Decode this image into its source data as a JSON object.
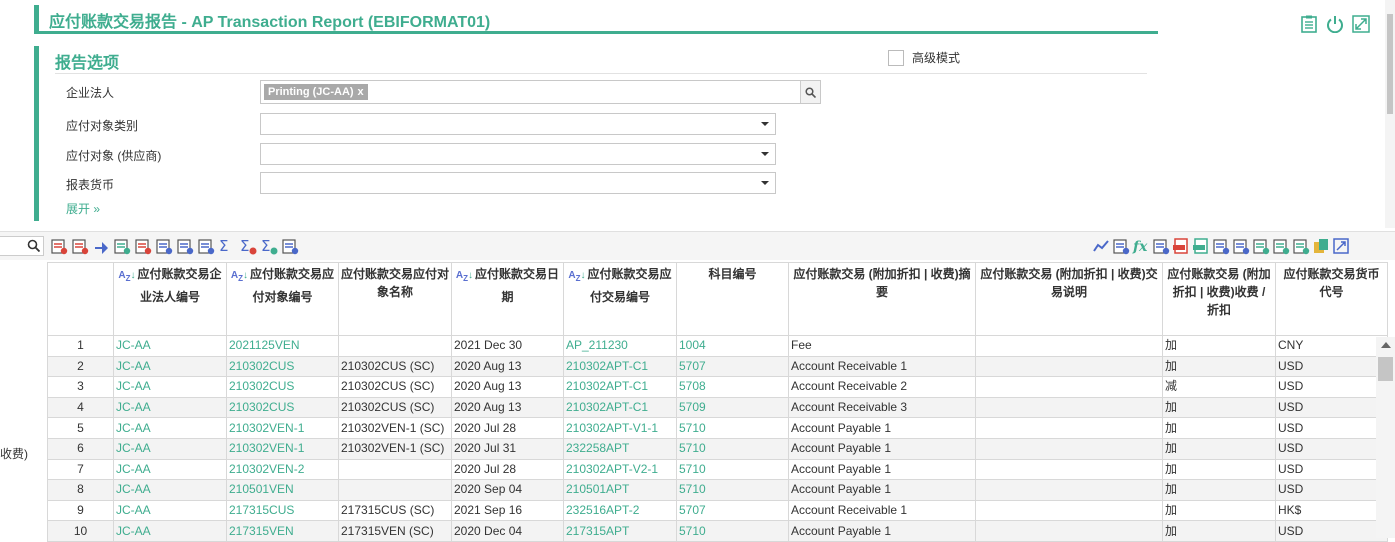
{
  "header": {
    "title": "应付账款交易报告 - AP Transaction Report (EBIFORMAT01)",
    "icons": [
      "clipboard-icon",
      "power-icon",
      "fullscreen-icon"
    ]
  },
  "options": {
    "section_title": "报告选项",
    "advanced_mode_label": "高级模式",
    "advanced_mode_checked": false,
    "fields": {
      "entity": {
        "label": "企业法人",
        "tag": "Printing (JC-AA)",
        "tag_remove": "x"
      },
      "vendor_type": {
        "label": "应付对象类别",
        "value": ""
      },
      "vendor": {
        "label": "应付对象 (供应商)",
        "value": ""
      },
      "currency": {
        "label": "报表货币",
        "value": ""
      }
    },
    "expand_label": "展开",
    "expand_icon": "chevron-double-down-icon"
  },
  "toolbar": {
    "left_icons": [
      "column-remove-icon",
      "row-remove-icon",
      "run-icon",
      "add-page-icon",
      "remove-page-icon",
      "column-split-icon",
      "fit-width-icon",
      "span-icon",
      "sum-icon",
      "sum-remove-icon",
      "sum-settings-icon",
      "report-settings-icon"
    ],
    "right_icons": [
      "chart-icon",
      "export-list-icon",
      "formula-icon",
      "search-doc-icon",
      "pdf-icon",
      "xlsx-icon",
      "settings-icon",
      "print-icon",
      "save-icon",
      "save-as-icon",
      "save-new-icon",
      "copy-icon",
      "expand-icon"
    ]
  },
  "side_text": "收费)",
  "grid": {
    "columns": [
      {
        "label": "",
        "sortable": false
      },
      {
        "label": "应付账款交易企业法人编号",
        "sortable": true
      },
      {
        "label": "应付账款交易应付对象编号",
        "sortable": true
      },
      {
        "label": "应付账款交易应付对象名称",
        "sortable": false
      },
      {
        "label": "应付账款交易日期",
        "sortable": true
      },
      {
        "label": "应付账款交易应付交易编号",
        "sortable": true
      },
      {
        "label": "科目编号",
        "sortable": false
      },
      {
        "label": "应付账款交易 (附加折扣 | 收费)摘要",
        "sortable": false
      },
      {
        "label": "应付账款交易 (附加折扣 | 收费)交易说明",
        "sortable": false
      },
      {
        "label": "应付账款交易 (附加折扣 | 收费)收费 / 折扣",
        "sortable": false
      },
      {
        "label": "应付账款交易货币代号",
        "sortable": false
      }
    ],
    "rows": [
      [
        "1",
        "JC-AA",
        "2021125VEN",
        "",
        "2021 Dec 30",
        "AP_211230",
        "1004",
        "Fee",
        "",
        "加",
        "CNY"
      ],
      [
        "2",
        "JC-AA",
        "210302CUS",
        "210302CUS (SC)",
        "2020 Aug 13",
        "210302APT-C1",
        "5707",
        "Account Receivable 1",
        "",
        "加",
        "USD"
      ],
      [
        "3",
        "JC-AA",
        "210302CUS",
        "210302CUS (SC)",
        "2020 Aug 13",
        "210302APT-C1",
        "5708",
        "Account Receivable 2",
        "",
        "减",
        "USD"
      ],
      [
        "4",
        "JC-AA",
        "210302CUS",
        "210302CUS (SC)",
        "2020 Aug 13",
        "210302APT-C1",
        "5709",
        "Account Receivable 3",
        "",
        "加",
        "USD"
      ],
      [
        "5",
        "JC-AA",
        "210302VEN-1",
        "210302VEN-1 (SC)",
        "2020 Jul 28",
        "210302APT-V1-1",
        "5710",
        "Account Payable 1",
        "",
        "加",
        "USD"
      ],
      [
        "6",
        "JC-AA",
        "210302VEN-1",
        "210302VEN-1 (SC)",
        "2020 Jul 31",
        "232258APT",
        "5710",
        "Account Payable 1",
        "",
        "加",
        "USD"
      ],
      [
        "7",
        "JC-AA",
        "210302VEN-2",
        "",
        "2020 Jul 28",
        "210302APT-V2-1",
        "5710",
        "Account Payable 1",
        "",
        "加",
        "USD"
      ],
      [
        "8",
        "JC-AA",
        "210501VEN",
        "",
        "2020 Sep 04",
        "210501APT",
        "5710",
        "Account Payable 1",
        "",
        "加",
        "USD"
      ],
      [
        "9",
        "JC-AA",
        "217315CUS",
        "217315CUS (SC)",
        "2021 Sep 16",
        "232516APT-2",
        "5707",
        "Account Receivable 1",
        "",
        "加",
        "HK$"
      ],
      [
        "10",
        "JC-AA",
        "217315VEN",
        "217315VEN (SC)",
        "2020 Dec 04",
        "217315APT",
        "5710",
        "Account Payable 1",
        "",
        "加",
        "USD"
      ]
    ]
  },
  "colors": {
    "accent": "#3fad8f",
    "sort_blue": "#5a6fd0",
    "row_alt": "#f3f3f3"
  }
}
